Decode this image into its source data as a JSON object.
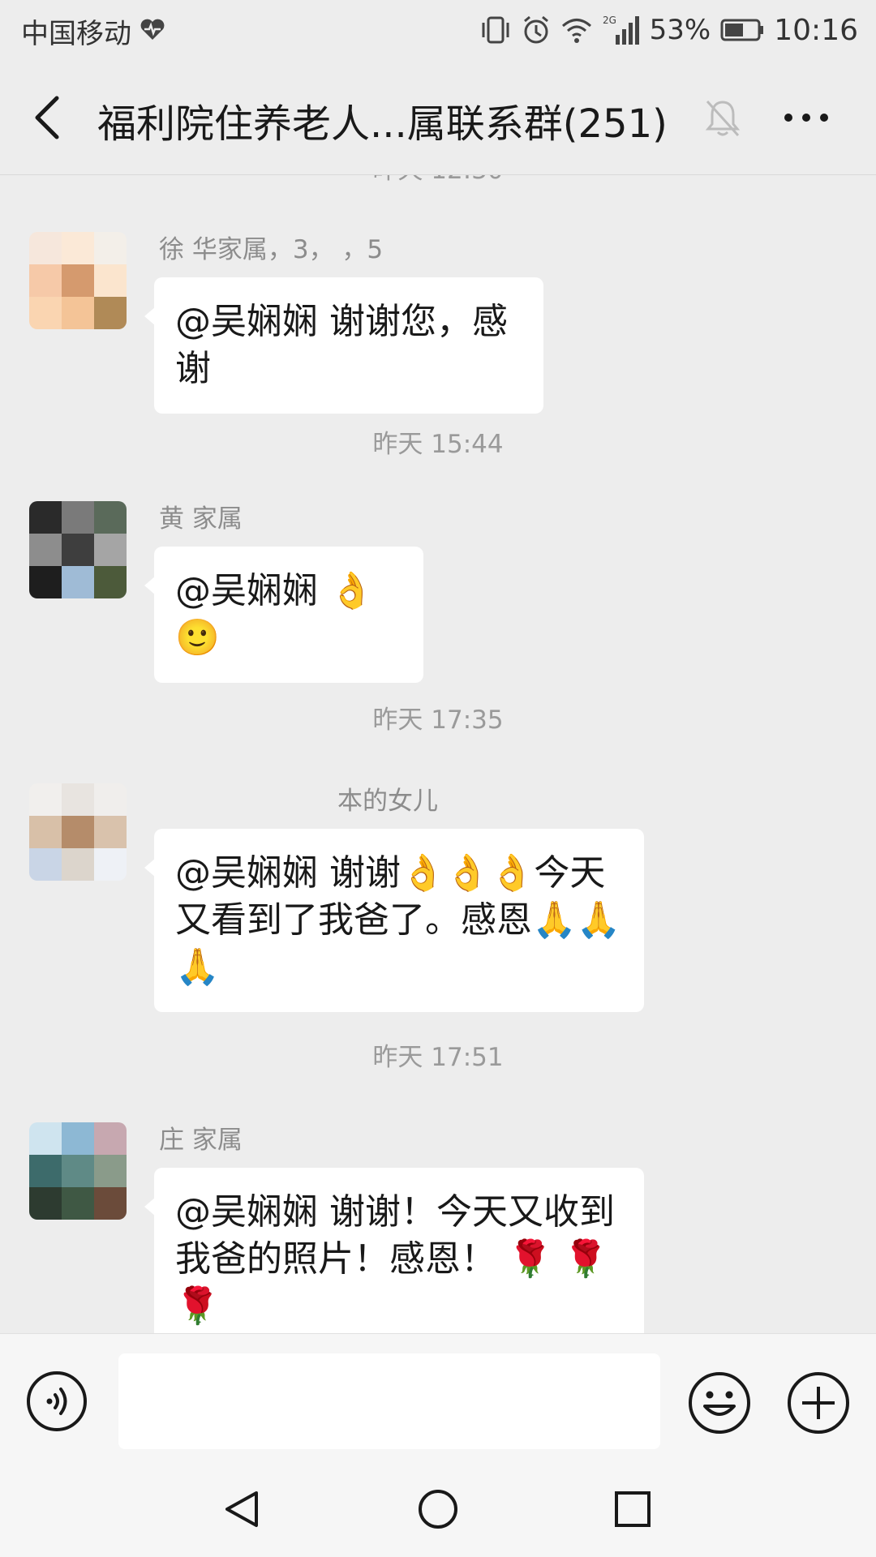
{
  "status_bar": {
    "carrier": "中国移动",
    "network": "2G",
    "battery": "53%",
    "time": "10:16"
  },
  "header": {
    "title": "福利院住养老人...属联系群(251)"
  },
  "messages": [
    {
      "sender": "徐 华家属，3， ，5",
      "text": "@吴娴娴  谢谢您，感谢"
    },
    {
      "timestamp": "昨天 15:44",
      "sender": "黄 家属",
      "text": "@吴娴娴  👌🙂"
    },
    {
      "timestamp": "昨天 17:35",
      "sender": "本的女儿",
      "text": "@吴娴娴  谢谢👌👌👌今天又看到了我爸了。感恩🙏🙏🙏"
    },
    {
      "timestamp": "昨天 17:51",
      "sender": "庄 家属",
      "text": "@吴娴娴  谢谢！今天又收到我爸的照片！感恩！ 🌹 🌹 🌹"
    }
  ],
  "icons": {
    "back": "back-chevron-icon",
    "mute": "bell-mute-icon",
    "more": "more-dots-icon",
    "voice": "voice-icon",
    "emoji": "emoji-icon",
    "plus": "plus-icon"
  },
  "colors": {
    "background": "#ededed",
    "bubble": "#ffffff",
    "timestamp": "#9a9a9a",
    "sender": "#8c8c8c"
  }
}
